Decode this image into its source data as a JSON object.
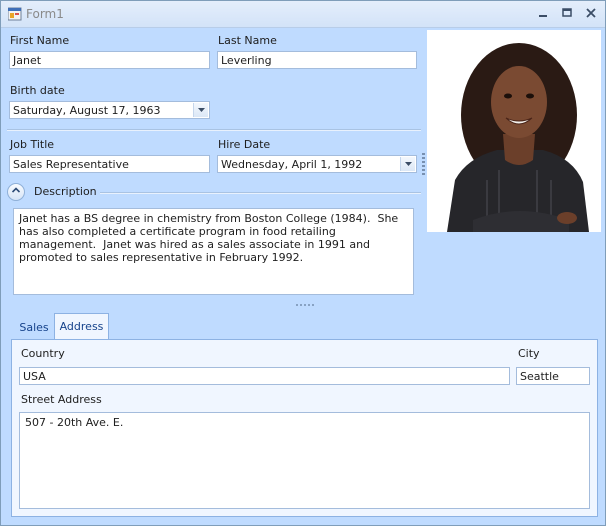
{
  "window": {
    "title": "Form1"
  },
  "employee": {
    "first_name_label": "First Name",
    "first_name": "Janet",
    "last_name_label": "Last Name",
    "last_name": "Leverling",
    "birth_date_label": "Birth date",
    "birth_date": "Saturday, August 17, 1963",
    "job_title_label": "Job Title",
    "job_title": "Sales Representative",
    "hire_date_label": "Hire Date",
    "hire_date": "Wednesday, April 1, 1992",
    "description_label": "Description",
    "description": "Janet has a BS degree in chemistry from Boston College (1984).  She has also completed a certificate program in food retailing management.  Janet was hired as a sales associate in 1991 and promoted to sales representative in February 1992."
  },
  "tabs": [
    {
      "label": "Sales",
      "selected": false
    },
    {
      "label": "Address",
      "selected": true
    }
  ],
  "address": {
    "country_label": "Country",
    "country": "USA",
    "city_label": "City",
    "city": "Seattle",
    "street_label": "Street Address",
    "street": "507 - 20th Ave. E."
  },
  "icons": {
    "app": "form-app-icon",
    "minimize": "minimize-icon",
    "maximize": "maximize-icon",
    "close": "close-icon",
    "dropdown": "chevron-down-icon",
    "collapse": "chevron-up-icon"
  },
  "colors": {
    "form_background": "#bfdbff",
    "tab_page": "#f0f6ff",
    "tab_text": "#15428b",
    "border": "#a4bcdc"
  }
}
